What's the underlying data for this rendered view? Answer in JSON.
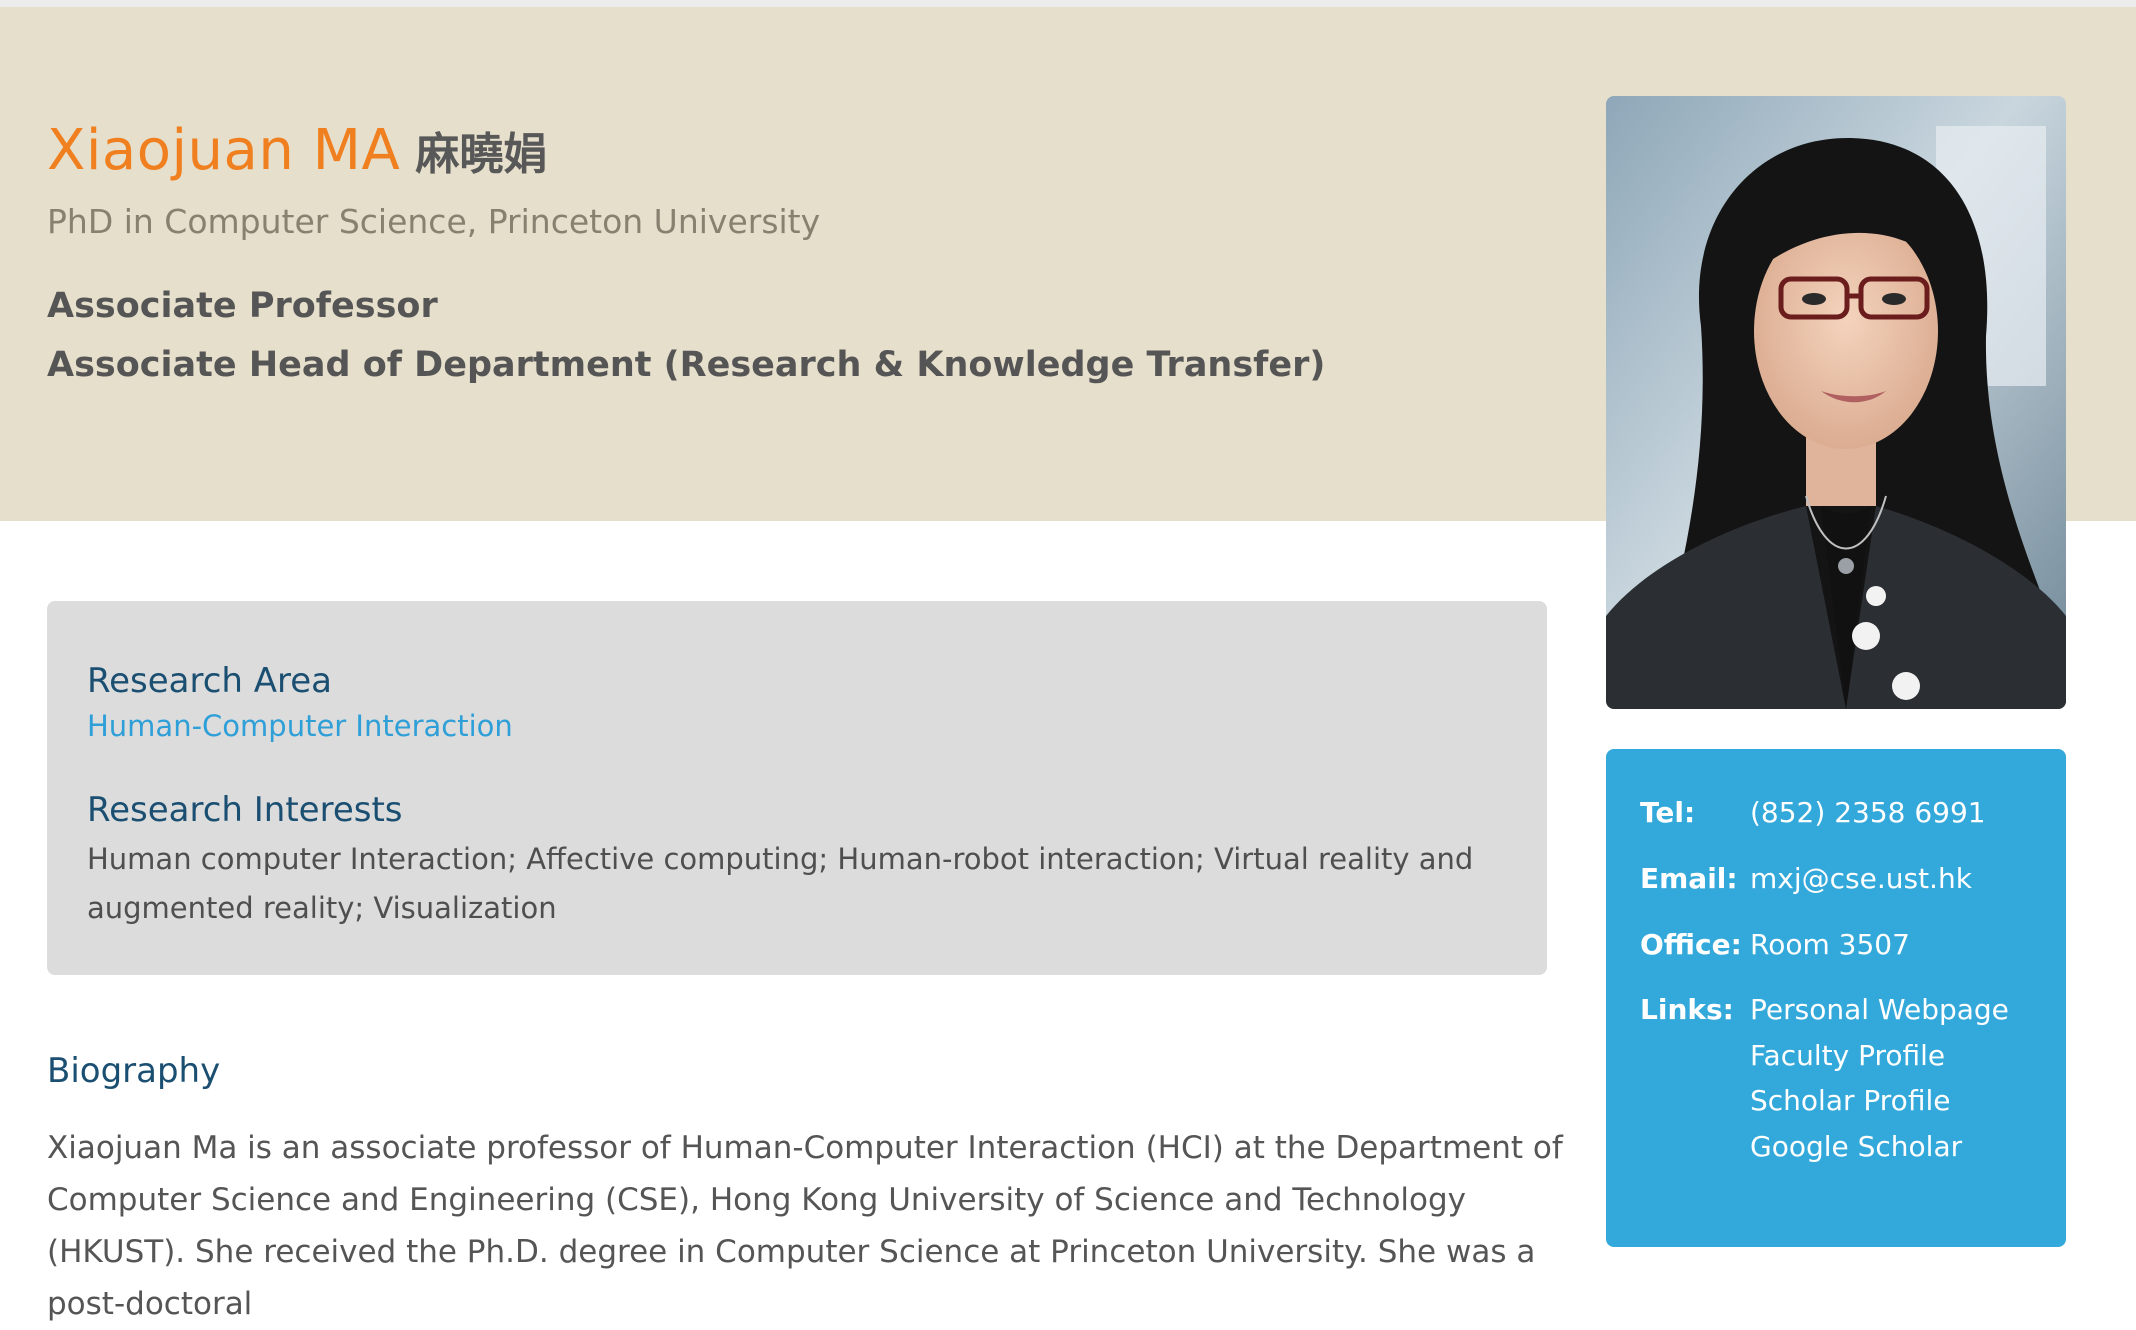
{
  "header": {
    "name_en": "Xiaojuan MA",
    "name_zh": "麻曉娟",
    "degree": "PhD in Computer Science, Princeton University",
    "positions": [
      "Associate Professor",
      "Associate Head of Department (Research & Knowledge Transfer)"
    ]
  },
  "research": {
    "area_heading": "Research Area",
    "area_link": "Human-Computer Interaction",
    "interests_heading": "Research Interests",
    "interests_text": "Human computer Interaction; Affective computing; Human-robot interaction; Virtual reality and augmented reality; Visualization"
  },
  "biography": {
    "heading": "Biography",
    "text": "Xiaojuan Ma is an associate professor of Human-Computer Interaction (HCI) at the Department of Computer Science and Engineering (CSE), Hong Kong University of Science and Technology (HKUST). She received the Ph.D. degree in Computer Science at Princeton University. She was a post-doctoral"
  },
  "contact": {
    "tel_label": "Tel:",
    "tel_value": "(852) 2358 6991",
    "email_label": "Email:",
    "email_value": "mxj@cse.ust.hk",
    "office_label": "Office:",
    "office_value": "Room 3507",
    "links_label": "Links:",
    "links": [
      "Personal Webpage",
      "Faculty Profile",
      "Scholar Profile",
      "Google Scholar"
    ]
  },
  "colors": {
    "band": "#e6dfcc",
    "name_accent": "#f0801f",
    "heading_blue": "#1b4f72",
    "link_blue": "#2f9fd8",
    "card_blue": "#33a8da",
    "research_box": "#dcdcdc"
  }
}
